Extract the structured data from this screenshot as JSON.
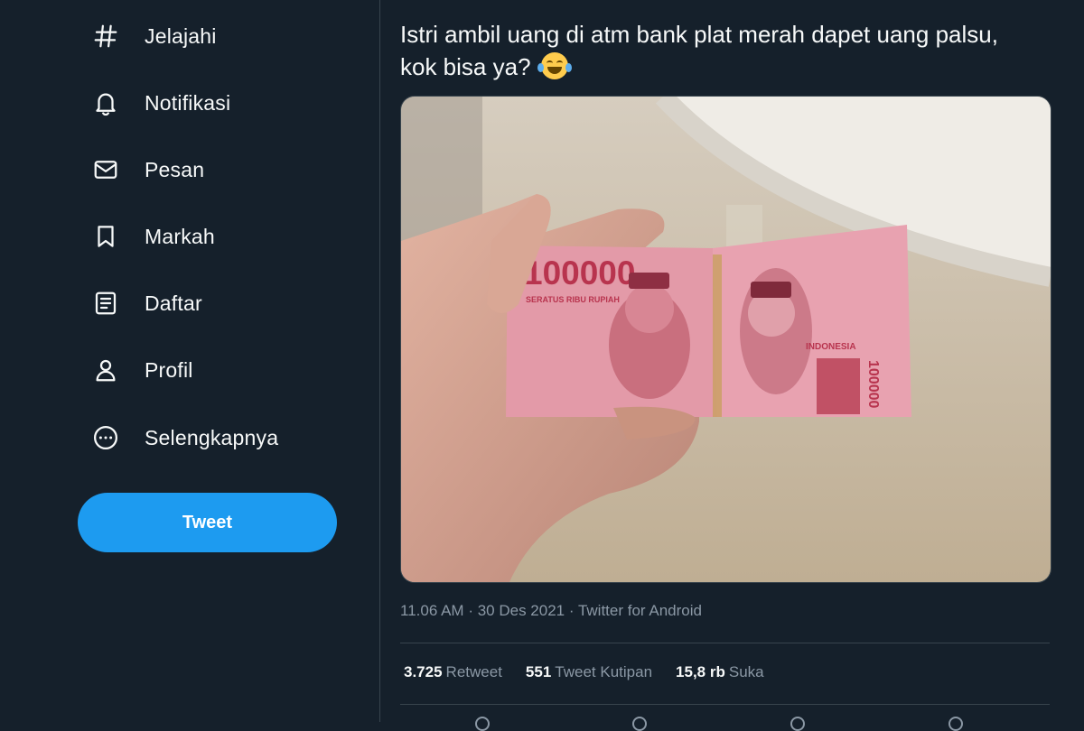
{
  "sidebar": {
    "items": [
      {
        "label": "Jelajahi",
        "icon": "hashtag-icon"
      },
      {
        "label": "Notifikasi",
        "icon": "bell-icon"
      },
      {
        "label": "Pesan",
        "icon": "envelope-icon"
      },
      {
        "label": "Markah",
        "icon": "bookmark-icon"
      },
      {
        "label": "Daftar",
        "icon": "list-icon"
      },
      {
        "label": "Profil",
        "icon": "person-icon"
      },
      {
        "label": "Selengkapnya",
        "icon": "more-circle-icon"
      }
    ],
    "tweet_button_label": "Tweet"
  },
  "tweet": {
    "text": "Istri ambil uang di atm bank plat merah dapet uang palsu, kok bisa ya?",
    "emoji": "face-with-tears-of-joy-icon",
    "photo": {
      "banknote_value": "100000",
      "banknote_words": "SERATUS RIBU RUPIAH",
      "banknote_country": "INDONESIA"
    },
    "time": "11.06 AM",
    "separator": "·",
    "date": "30 Des 2021",
    "source": "Twitter for Android",
    "stats": {
      "retweets_count": "3.725",
      "retweets_label": "Retweet",
      "quotes_count": "551",
      "quotes_label": "Tweet Kutipan",
      "likes_count": "15,8 rb",
      "likes_label": "Suka"
    }
  },
  "colors": {
    "background": "#15202b",
    "accent": "#1d9bf0",
    "text_primary": "#f7f9f9",
    "text_secondary": "#8b98a5",
    "divider": "#38444d"
  }
}
